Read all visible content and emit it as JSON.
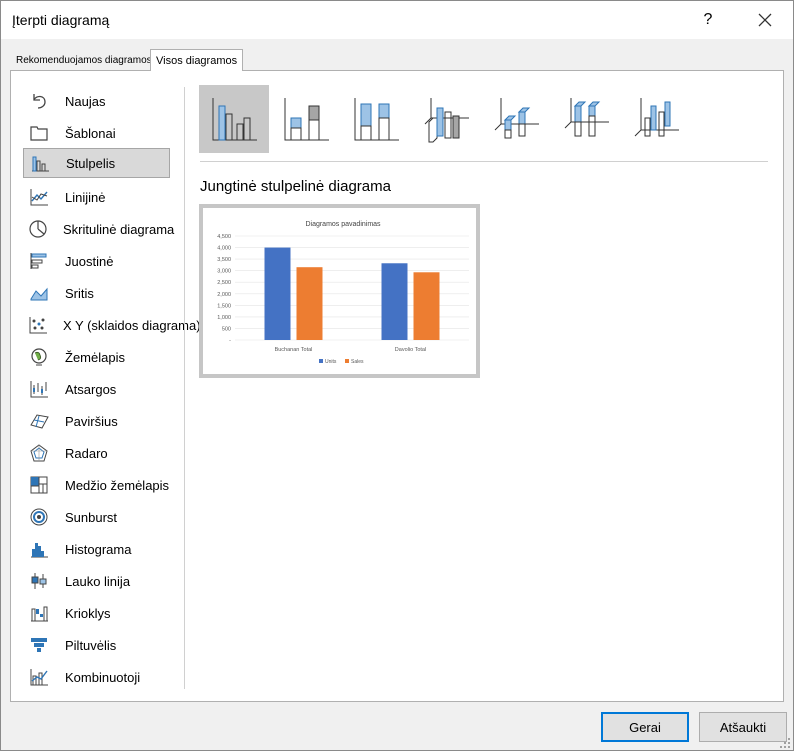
{
  "dialog": {
    "title": "Įterpti diagramą",
    "help": "?"
  },
  "tabs": {
    "recommended": "Rekomenduojamos diagramos",
    "all": "Visos diagramos"
  },
  "sidebar": {
    "items": [
      {
        "label": "Naujas",
        "icon": "undo-icon"
      },
      {
        "label": "Šablonai",
        "icon": "folder-icon"
      },
      {
        "label": "Stulpelis",
        "icon": "column-chart-icon"
      },
      {
        "label": "Linijinė",
        "icon": "line-chart-icon"
      },
      {
        "label": "Skritulinė diagrama",
        "icon": "pie-chart-icon"
      },
      {
        "label": "Juostinė",
        "icon": "bar-chart-icon"
      },
      {
        "label": "Sritis",
        "icon": "area-chart-icon"
      },
      {
        "label": "X Y (sklaidos diagrama)",
        "icon": "scatter-chart-icon"
      },
      {
        "label": "Žemėlapis",
        "icon": "map-chart-icon"
      },
      {
        "label": "Atsargos",
        "icon": "stock-chart-icon"
      },
      {
        "label": "Paviršius",
        "icon": "surface-chart-icon"
      },
      {
        "label": "Radaro",
        "icon": "radar-chart-icon"
      },
      {
        "label": "Medžio žemėlapis",
        "icon": "treemap-icon"
      },
      {
        "label": "Sunburst",
        "icon": "sunburst-icon"
      },
      {
        "label": "Histograma",
        "icon": "histogram-icon"
      },
      {
        "label": "Lauko linija",
        "icon": "box-whisker-icon"
      },
      {
        "label": "Krioklys",
        "icon": "waterfall-icon"
      },
      {
        "label": "Piltuvėlis",
        "icon": "funnel-icon"
      },
      {
        "label": "Kombinuotoji",
        "icon": "combo-chart-icon"
      }
    ],
    "selected": "Stulpelis"
  },
  "subtypes": [
    {
      "icon": "clustered-column-icon"
    },
    {
      "icon": "stacked-column-icon"
    },
    {
      "icon": "100-stacked-column-icon"
    },
    {
      "icon": "3d-clustered-column-icon"
    },
    {
      "icon": "3d-stacked-column-icon"
    },
    {
      "icon": "3d-100-stacked-column-icon"
    },
    {
      "icon": "3d-column-icon"
    }
  ],
  "selected_subtype_heading": "Jungtinė stulpelinė diagrama",
  "chart_data": {
    "type": "bar",
    "title": "Diagramos pavadinimas",
    "categories": [
      "Buchanan Total",
      "Davolio Total"
    ],
    "series": [
      {
        "name": "Units",
        "values": [
          4000,
          3320
        ],
        "color": "#4472c4"
      },
      {
        "name": "Sales",
        "values": [
          3150,
          2930
        ],
        "color": "#ed7d31"
      }
    ],
    "ylim": [
      0,
      4500
    ],
    "yticks": [
      "-",
      "500",
      "1,000",
      "1,500",
      "2,000",
      "2,500",
      "3,000",
      "3,500",
      "4,000",
      "4,500"
    ],
    "grid": true,
    "legend": "bottom"
  },
  "buttons": {
    "ok": "Gerai",
    "cancel": "Atšaukti"
  },
  "colors": {
    "accent": "#0078d7",
    "selection": "#d9d9d9",
    "icon_blue": "#2e75b6"
  }
}
